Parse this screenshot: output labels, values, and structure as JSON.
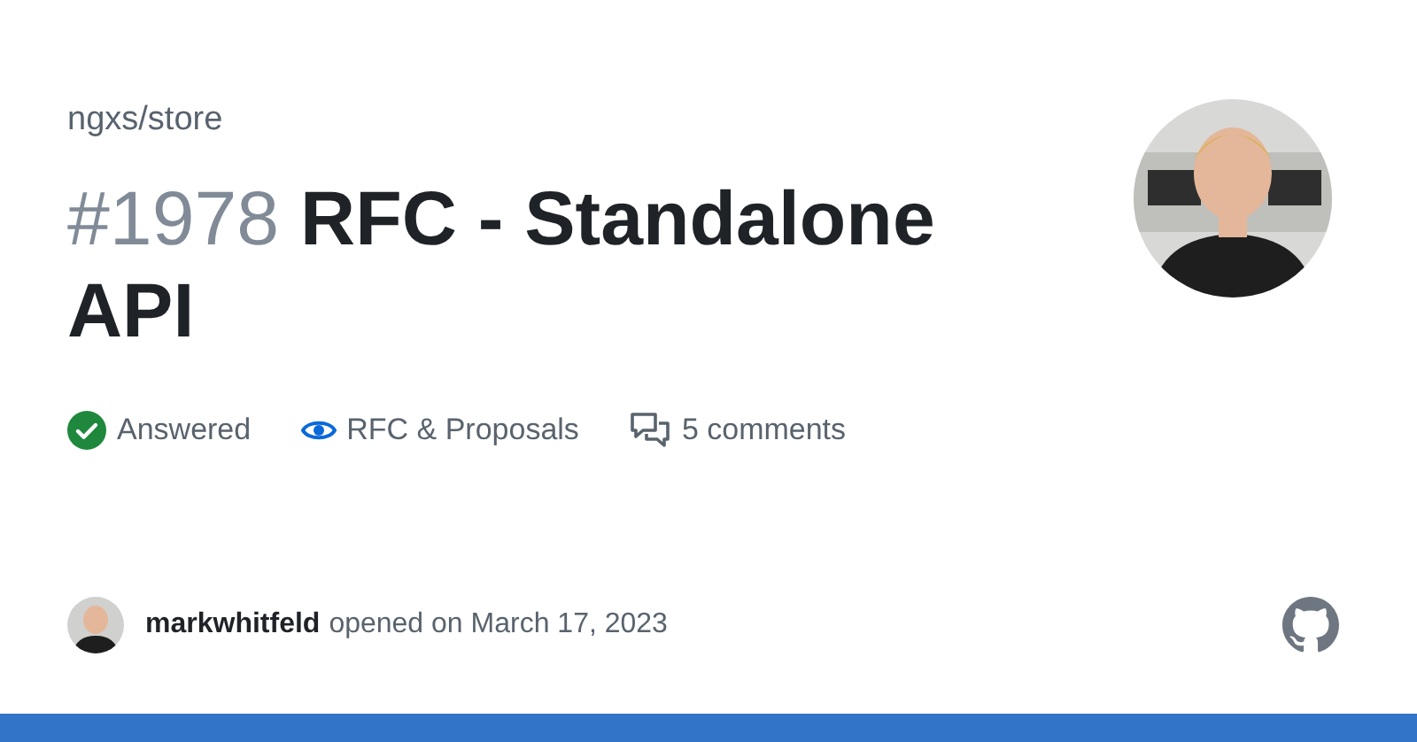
{
  "repo": "ngxs/store",
  "issue": {
    "number": "#1978",
    "title": "RFC - Standalone API"
  },
  "meta": [
    {
      "kind": "status",
      "label": "Answered"
    },
    {
      "kind": "category",
      "label": "RFC & Proposals"
    },
    {
      "kind": "comments",
      "label": "5 comments"
    }
  ],
  "author": {
    "name": "markwhitfeld",
    "action": "opened on March 17, 2023"
  }
}
